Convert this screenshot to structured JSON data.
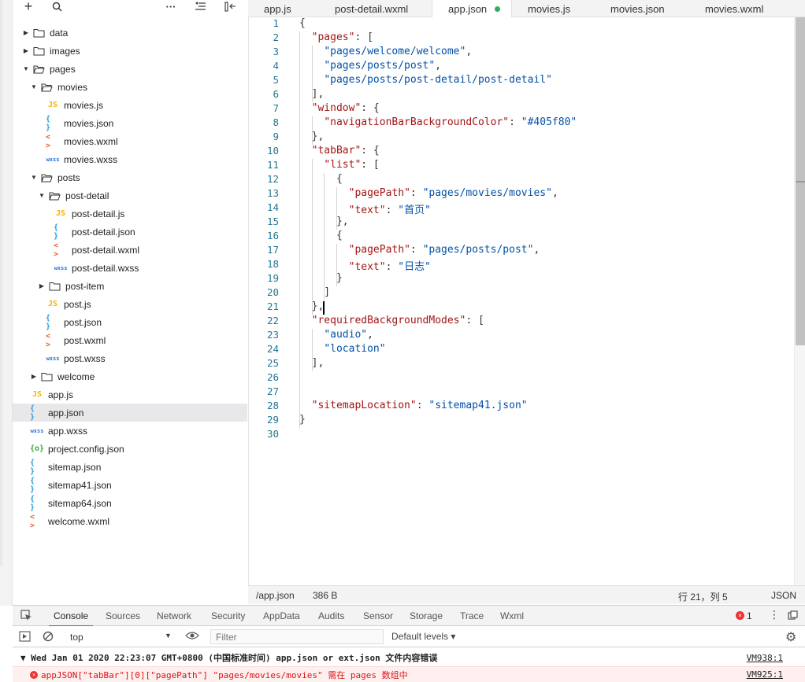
{
  "explorer": {
    "toolbar": {
      "add": "+",
      "search": "🔍",
      "more": "···",
      "collapse": "≡",
      "split": "⊫"
    },
    "items": [
      {
        "label": "data",
        "kind": "folder",
        "open": false,
        "depth": 0
      },
      {
        "label": "images",
        "kind": "folder",
        "open": false,
        "depth": 0
      },
      {
        "label": "pages",
        "kind": "folder",
        "open": true,
        "depth": 0
      },
      {
        "label": "movies",
        "kind": "folder",
        "open": true,
        "depth": 1
      },
      {
        "label": "movies.js",
        "kind": "js",
        "depth": 2
      },
      {
        "label": "movies.json",
        "kind": "json",
        "depth": 2
      },
      {
        "label": "movies.wxml",
        "kind": "wxml",
        "depth": 2
      },
      {
        "label": "movies.wxss",
        "kind": "wxss",
        "depth": 2
      },
      {
        "label": "posts",
        "kind": "folder",
        "open": true,
        "depth": 1
      },
      {
        "label": "post-detail",
        "kind": "folder",
        "open": true,
        "depth": 2
      },
      {
        "label": "post-detail.js",
        "kind": "js",
        "depth": 3
      },
      {
        "label": "post-detail.json",
        "kind": "json",
        "depth": 3
      },
      {
        "label": "post-detail.wxml",
        "kind": "wxml",
        "depth": 3
      },
      {
        "label": "post-detail.wxss",
        "kind": "wxss",
        "depth": 3
      },
      {
        "label": "post-item",
        "kind": "folder",
        "open": false,
        "depth": 2
      },
      {
        "label": "post.js",
        "kind": "js",
        "depth": 2
      },
      {
        "label": "post.json",
        "kind": "json",
        "depth": 2
      },
      {
        "label": "post.wxml",
        "kind": "wxml",
        "depth": 2
      },
      {
        "label": "post.wxss",
        "kind": "wxss",
        "depth": 2
      },
      {
        "label": "welcome",
        "kind": "folder",
        "open": false,
        "depth": 1
      },
      {
        "label": "app.js",
        "kind": "js",
        "depth": 0
      },
      {
        "label": "app.json",
        "kind": "json",
        "depth": 0,
        "selected": true
      },
      {
        "label": "app.wxss",
        "kind": "wxss",
        "depth": 0
      },
      {
        "label": "project.config.json",
        "kind": "cfg",
        "depth": 0
      },
      {
        "label": "sitemap.json",
        "kind": "json",
        "depth": 0
      },
      {
        "label": "sitemap41.json",
        "kind": "json",
        "depth": 0
      },
      {
        "label": "sitemap64.json",
        "kind": "json",
        "depth": 0
      },
      {
        "label": "welcome.wxml",
        "kind": "wxml",
        "depth": 0
      }
    ],
    "icons": {
      "js": "JS",
      "json": "{ }",
      "wxml": "< >",
      "wxss": "wxss",
      "cfg": "{o}"
    }
  },
  "tabs": [
    {
      "label": "app.js"
    },
    {
      "label": "post-detail.wxml"
    },
    {
      "label": "app.json",
      "active": true,
      "modified": true
    },
    {
      "label": "movies.js"
    },
    {
      "label": "movies.json"
    },
    {
      "label": "movies.wxml"
    }
  ],
  "code_lines": [
    "{",
    "  \"pages\": [",
    "    \"pages/welcome/welcome\",",
    "    \"pages/posts/post\",",
    "    \"pages/posts/post-detail/post-detail\"",
    "  ],",
    "  \"window\": {",
    "    \"navigationBarBackgroundColor\": \"#405f80\"",
    "  },",
    "  \"tabBar\": {",
    "    \"list\": [",
    "      {",
    "        \"pagePath\": \"pages/movies/movies\",",
    "        \"text\": \"首页\"",
    "      },",
    "      {",
    "        \"pagePath\": \"pages/posts/post\",",
    "        \"text\": \"日志\"",
    "      }",
    "    ]",
    "  },",
    "  \"requiredBackgroundModes\": [",
    "    \"audio\",",
    "    \"location\"",
    "  ],",
    "",
    "",
    "  \"sitemapLocation\": \"sitemap41.json\"",
    "}",
    ""
  ],
  "status": {
    "path": "/app.json",
    "size": "386 B",
    "position": "行 21，列 5",
    "language": "JSON"
  },
  "devtools": {
    "tabs": [
      "Console",
      "Sources",
      "Network",
      "Security",
      "AppData",
      "Audits",
      "Sensor",
      "Storage",
      "Trace",
      "Wxml"
    ],
    "active_tab": "Console",
    "error_count": "1",
    "context": "top",
    "filter_placeholder": "Filter",
    "levels": "Default levels ▾",
    "messages": [
      {
        "text": "▼ Wed Jan 01 2020 22:23:07 GMT+0800 (中国标准时间)  app.json or ext.json 文件内容错误",
        "source": "VM938:1",
        "level": "group"
      },
      {
        "text": "appJSON[\"tabBar\"][0][\"pagePath\"] \"pages/movies/movies\" 需在 pages 数组中",
        "source": "VM925:1",
        "level": "error"
      }
    ]
  }
}
